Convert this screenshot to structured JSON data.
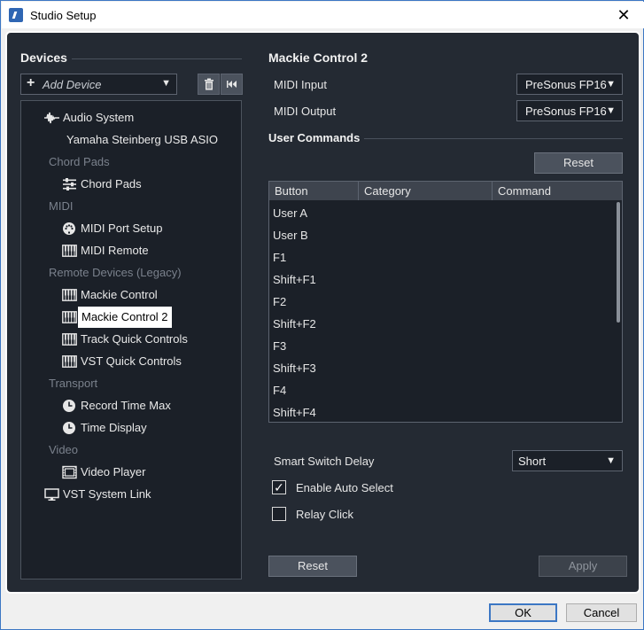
{
  "window": {
    "title": "Studio Setup"
  },
  "left": {
    "section_title": "Devices",
    "add_device_label": "Add Device",
    "tree": [
      {
        "type": "device",
        "label": "Audio System",
        "icon": "waveform-icon"
      },
      {
        "type": "sub",
        "label": "Yamaha Steinberg USB ASIO"
      },
      {
        "type": "category",
        "label": "Chord Pads"
      },
      {
        "type": "device",
        "label": "Chord Pads",
        "icon": "sliders-icon"
      },
      {
        "type": "category",
        "label": "MIDI"
      },
      {
        "type": "device",
        "label": "MIDI Port Setup",
        "icon": "midi-port-icon"
      },
      {
        "type": "device",
        "label": "MIDI Remote",
        "icon": "keyboard-icon"
      },
      {
        "type": "category",
        "label": "Remote Devices (Legacy)"
      },
      {
        "type": "device",
        "label": "Mackie Control",
        "icon": "keyboard-icon"
      },
      {
        "type": "device",
        "label": "Mackie Control 2",
        "icon": "keyboard-icon",
        "selected": true
      },
      {
        "type": "device",
        "label": "Track Quick Controls",
        "icon": "keyboard-icon"
      },
      {
        "type": "device",
        "label": "VST Quick Controls",
        "icon": "keyboard-icon"
      },
      {
        "type": "category",
        "label": "Transport"
      },
      {
        "type": "device",
        "label": "Record Time Max",
        "icon": "clock-icon"
      },
      {
        "type": "device",
        "label": "Time Display",
        "icon": "clock-icon"
      },
      {
        "type": "category",
        "label": "Video"
      },
      {
        "type": "device",
        "label": "Video Player",
        "icon": "film-icon"
      },
      {
        "type": "root",
        "label": "VST System Link",
        "icon": "monitor-icon"
      }
    ]
  },
  "right": {
    "title": "Mackie Control 2",
    "midi_input_label": "MIDI Input",
    "midi_input_value": "PreSonus FP16",
    "midi_output_label": "MIDI Output",
    "midi_output_value": "PreSonus FP16",
    "user_commands_title": "User Commands",
    "reset_label": "Reset",
    "table": {
      "columns": [
        "Button",
        "Category",
        "Command"
      ],
      "rows": [
        "User A",
        "User B",
        "F1",
        "Shift+F1",
        "F2",
        "Shift+F2",
        "F3",
        "Shift+F3",
        "F4",
        "Shift+F4"
      ]
    },
    "smart_switch_label": "Smart Switch Delay",
    "smart_switch_value": "Short",
    "enable_auto_select_label": "Enable Auto Select",
    "enable_auto_select_checked": true,
    "relay_click_label": "Relay Click",
    "relay_click_checked": false,
    "bottom_reset_label": "Reset",
    "apply_label": "Apply"
  },
  "footer": {
    "ok_label": "OK",
    "cancel_label": "Cancel"
  },
  "colors": {
    "panel_bg": "#242a33",
    "field_bg": "#1b2028",
    "accent": "#3c77c4"
  }
}
